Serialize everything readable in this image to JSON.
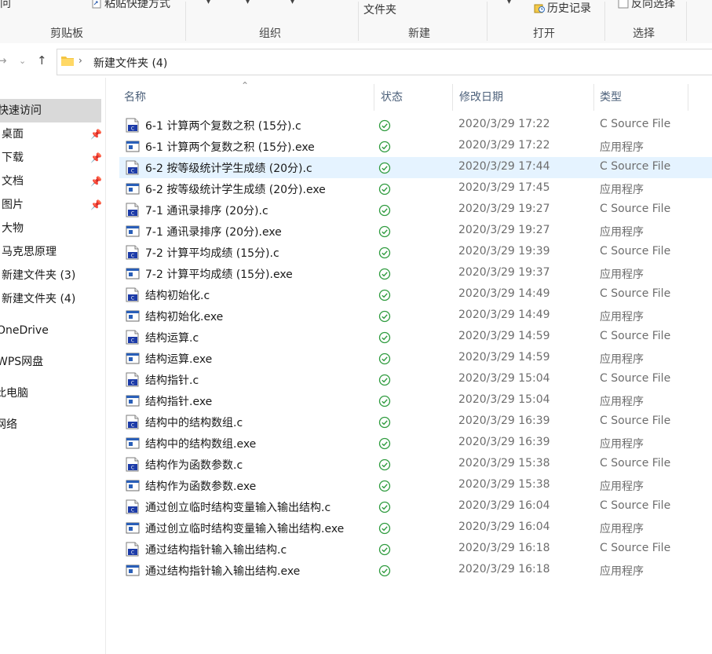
{
  "ribbon": {
    "top_partial_labels": {
      "clip_char": "问",
      "paste_shortcut": "粘贴快捷方式",
      "new_folder": "文件夹",
      "history": "历史记录",
      "invert_select": "反向选择"
    },
    "groups": [
      {
        "label": "剪贴板"
      },
      {
        "label": "组织"
      },
      {
        "label": "新建"
      },
      {
        "label": "打开"
      },
      {
        "label": "选择"
      }
    ]
  },
  "address": {
    "path": "新建文件夹 (4)"
  },
  "sidebar": {
    "items": [
      {
        "label": "快速访问",
        "pinned": false,
        "selected": true
      },
      {
        "label": "桌面",
        "pinned": true
      },
      {
        "label": "下载",
        "pinned": true
      },
      {
        "label": "文档",
        "pinned": true
      },
      {
        "label": "图片",
        "pinned": true
      },
      {
        "label": "大物",
        "pinned": false
      },
      {
        "label": "马克思原理",
        "pinned": false
      },
      {
        "label": "新建文件夹 (3)",
        "pinned": false
      },
      {
        "label": "新建文件夹 (4)",
        "pinned": false
      },
      {
        "label": "OneDrive",
        "pinned": false
      },
      {
        "label": "WPS网盘",
        "pinned": false
      },
      {
        "label": "此电脑",
        "pinned": false
      },
      {
        "label": "网络",
        "pinned": false
      }
    ]
  },
  "columns": {
    "name": "名称",
    "status": "状态",
    "modified": "修改日期",
    "type": "类型"
  },
  "files": [
    {
      "name": "6-1 计算两个复数之积 (15分).c",
      "modified": "2020/3/29 17:22",
      "type": "C Source File",
      "kind": "c"
    },
    {
      "name": "6-1 计算两个复数之积 (15分).exe",
      "modified": "2020/3/29 17:22",
      "type": "应用程序",
      "kind": "exe"
    },
    {
      "name": "6-2 按等级统计学生成绩 (20分).c",
      "modified": "2020/3/29 17:44",
      "type": "C Source File",
      "kind": "c",
      "hover": true
    },
    {
      "name": "6-2 按等级统计学生成绩 (20分).exe",
      "modified": "2020/3/29 17:45",
      "type": "应用程序",
      "kind": "exe"
    },
    {
      "name": "7-1 通讯录排序 (20分).c",
      "modified": "2020/3/29 19:27",
      "type": "C Source File",
      "kind": "c"
    },
    {
      "name": "7-1 通讯录排序 (20分).exe",
      "modified": "2020/3/29 19:27",
      "type": "应用程序",
      "kind": "exe"
    },
    {
      "name": "7-2 计算平均成绩 (15分).c",
      "modified": "2020/3/29 19:39",
      "type": "C Source File",
      "kind": "c"
    },
    {
      "name": "7-2 计算平均成绩 (15分).exe",
      "modified": "2020/3/29 19:37",
      "type": "应用程序",
      "kind": "exe"
    },
    {
      "name": "结构初始化.c",
      "modified": "2020/3/29 14:49",
      "type": "C Source File",
      "kind": "c"
    },
    {
      "name": "结构初始化.exe",
      "modified": "2020/3/29 14:49",
      "type": "应用程序",
      "kind": "exe"
    },
    {
      "name": "结构运算.c",
      "modified": "2020/3/29 14:59",
      "type": "C Source File",
      "kind": "c"
    },
    {
      "name": "结构运算.exe",
      "modified": "2020/3/29 14:59",
      "type": "应用程序",
      "kind": "exe"
    },
    {
      "name": "结构指针.c",
      "modified": "2020/3/29 15:04",
      "type": "C Source File",
      "kind": "c"
    },
    {
      "name": "结构指针.exe",
      "modified": "2020/3/29 15:04",
      "type": "应用程序",
      "kind": "exe"
    },
    {
      "name": "结构中的结构数组.c",
      "modified": "2020/3/29 16:39",
      "type": "C Source File",
      "kind": "c"
    },
    {
      "name": "结构中的结构数组.exe",
      "modified": "2020/3/29 16:39",
      "type": "应用程序",
      "kind": "exe"
    },
    {
      "name": "结构作为函数参数.c",
      "modified": "2020/3/29 15:38",
      "type": "C Source File",
      "kind": "c"
    },
    {
      "name": "结构作为函数参数.exe",
      "modified": "2020/3/29 15:38",
      "type": "应用程序",
      "kind": "exe"
    },
    {
      "name": "通过创立临时结构变量输入输出结构.c",
      "modified": "2020/3/29 16:04",
      "type": "C Source File",
      "kind": "c"
    },
    {
      "name": "通过创立临时结构变量输入输出结构.exe",
      "modified": "2020/3/29 16:04",
      "type": "应用程序",
      "kind": "exe"
    },
    {
      "name": "通过结构指针输入输出结构.c",
      "modified": "2020/3/29 16:18",
      "type": "C Source File",
      "kind": "c"
    },
    {
      "name": "通过结构指针输入输出结构.exe",
      "modified": "2020/3/29 16:18",
      "type": "应用程序",
      "kind": "exe"
    }
  ],
  "colors": {
    "hover_row": "#e5f3ff",
    "status_green": "#2e9b3e",
    "header_text": "#4c607a",
    "icon_blue": "#1c3ba8"
  }
}
